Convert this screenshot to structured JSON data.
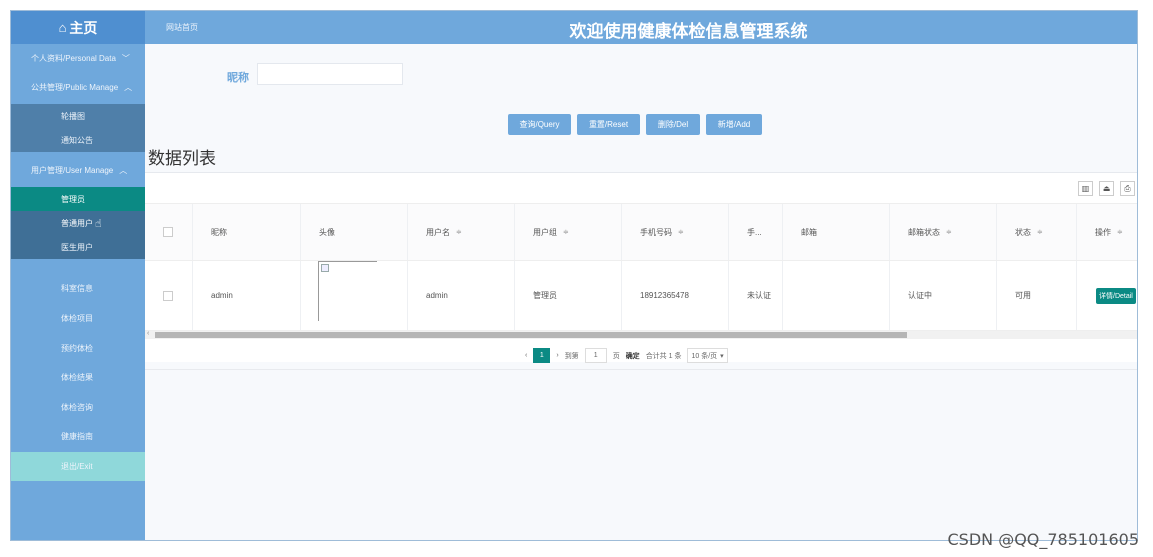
{
  "header": {
    "home_label": "主页",
    "breadcrumb": "网站首页",
    "system_title": "欢迎使用健康体检信息管理系统"
  },
  "sidebar": {
    "groups": [
      {
        "label": "个人资料/Personal Data",
        "chevron": "﹀"
      },
      {
        "label": "公共管理/Public Manage",
        "chevron": "︿"
      },
      {
        "label": "用户管理/User Manage",
        "chevron": "︿"
      }
    ],
    "public_items": [
      "轮播图",
      "通知公告"
    ],
    "user_items": [
      "管理员",
      "普通用户",
      "医生用户"
    ],
    "leaf_items": [
      "科室信息",
      "体检项目",
      "预约体检",
      "体检结果",
      "体检咨询",
      "健康指南"
    ],
    "exit_label": "退出/Exit"
  },
  "search": {
    "label": "昵称",
    "value": ""
  },
  "buttons": {
    "query": "查询/Query",
    "reset": "重置/Reset",
    "delete": "删除/Del",
    "add": "新增/Add"
  },
  "list_title": "数据列表",
  "table": {
    "headers": [
      "昵称",
      "头像",
      "用户名",
      "用户组",
      "手机号码",
      "手...",
      "邮箱",
      "邮箱状态",
      "状态",
      "操作"
    ],
    "sortable": [
      false,
      false,
      true,
      true,
      true,
      false,
      false,
      true,
      true,
      true
    ],
    "sort_glyph": "≑",
    "rows": [
      {
        "nickname": "admin",
        "username": "admin",
        "group": "管理员",
        "phone": "18912365478",
        "phone_status": "未认证",
        "email": "",
        "email_status": "认证中",
        "status": "可用",
        "action": "详情/Detail"
      }
    ]
  },
  "pagination": {
    "current_page": "1",
    "goto_label": "到第",
    "goto_value": "1",
    "page_suffix": "页",
    "confirm_label": "确定",
    "total_text": "合计共 1 条",
    "page_size": "10 条/页"
  },
  "watermark": "CSDN @QQ_785101605"
}
